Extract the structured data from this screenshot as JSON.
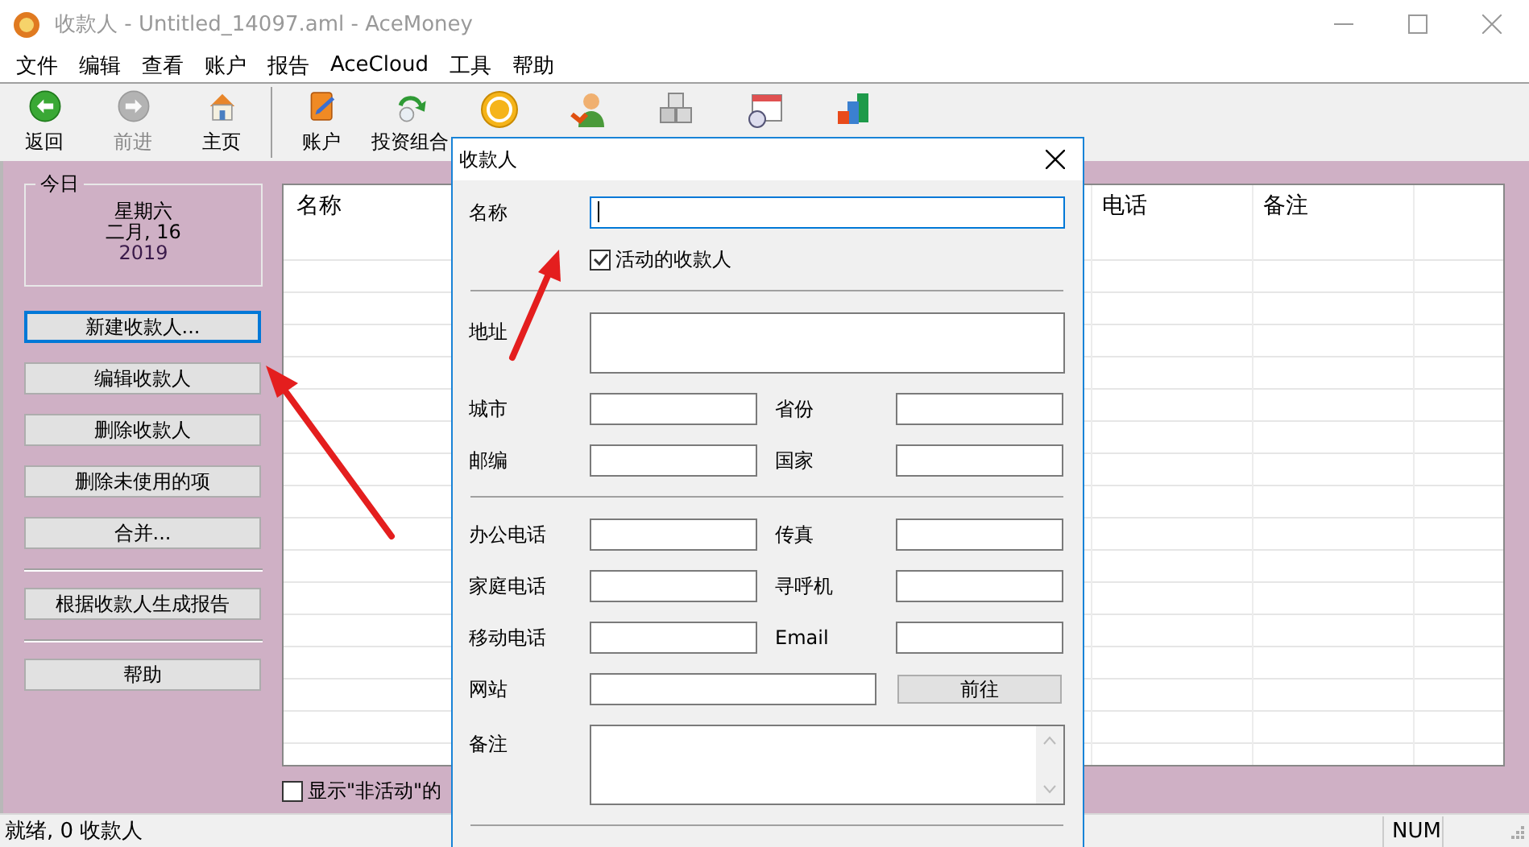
{
  "window": {
    "title": "收款人 - Untitled_14097.aml - AceMoney"
  },
  "menu": [
    "文件",
    "编辑",
    "查看",
    "账户",
    "报告",
    "AceCloud",
    "工具",
    "帮助"
  ],
  "toolbar": [
    {
      "kind": "back",
      "label": "返回",
      "disabled": false
    },
    {
      "kind": "forward",
      "label": "前进",
      "disabled": true
    },
    {
      "kind": "home",
      "label": "主页",
      "disabled": false
    },
    {
      "kind": "divider"
    },
    {
      "kind": "accounts",
      "label": "账户",
      "disabled": false
    },
    {
      "kind": "portfolio",
      "label": "投资组合",
      "disabled": false
    },
    {
      "kind": "coin",
      "disabled": false
    },
    {
      "kind": "person",
      "disabled": false
    },
    {
      "kind": "boxes",
      "disabled": false
    },
    {
      "kind": "calendar",
      "disabled": false
    },
    {
      "kind": "chart",
      "disabled": false
    }
  ],
  "today": {
    "title": "今日",
    "weekday": "星期六",
    "date": "二月, 16",
    "year": "2019"
  },
  "actions": [
    {
      "kind": "button",
      "label": "新建收款人...",
      "focused": true
    },
    {
      "kind": "button",
      "label": "编辑收款人",
      "focused": false
    },
    {
      "kind": "button",
      "label": "删除收款人",
      "focused": false
    },
    {
      "kind": "button",
      "label": "删除未使用的项",
      "focused": false
    },
    {
      "kind": "button",
      "label": "合并...",
      "focused": false
    },
    {
      "kind": "separator"
    },
    {
      "kind": "button",
      "label": "根据收款人生成报告",
      "focused": false
    },
    {
      "kind": "separator"
    },
    {
      "kind": "button",
      "label": "帮助",
      "focused": false
    }
  ],
  "table": {
    "columns": [
      {
        "label": "名称"
      },
      {
        "label": "电话"
      },
      {
        "label": "备注"
      }
    ]
  },
  "show_inactive": {
    "label": "显示\"非活动\"的",
    "checked": false
  },
  "status_bar": {
    "text": "就绪, 0 收款人",
    "num": "NUM"
  },
  "dialog": {
    "title": "收款人",
    "rows": [
      {
        "kind": "field",
        "label": "名称",
        "focused": true
      },
      {
        "kind": "checkbox",
        "label": "活动的收款人",
        "checked": true
      },
      {
        "kind": "separator"
      },
      {
        "kind": "textarea",
        "label": "地址"
      },
      {
        "kind": "pair",
        "fields": [
          {
            "label": "城市"
          },
          {
            "label": "省份"
          }
        ]
      },
      {
        "kind": "pair",
        "fields": [
          {
            "label": "邮编"
          },
          {
            "label": "国家"
          }
        ]
      },
      {
        "kind": "separator"
      },
      {
        "kind": "pair",
        "fields": [
          {
            "label": "办公电话"
          },
          {
            "label": "传真"
          }
        ]
      },
      {
        "kind": "pair",
        "fields": [
          {
            "label": "家庭电话"
          },
          {
            "label": "寻呼机"
          }
        ]
      },
      {
        "kind": "pair",
        "fields": [
          {
            "label": "移动电话"
          },
          {
            "label": "Email"
          }
        ]
      },
      {
        "kind": "link",
        "label": "网站",
        "button": "前往"
      },
      {
        "kind": "notes",
        "label": "备注"
      },
      {
        "kind": "separator"
      }
    ]
  }
}
